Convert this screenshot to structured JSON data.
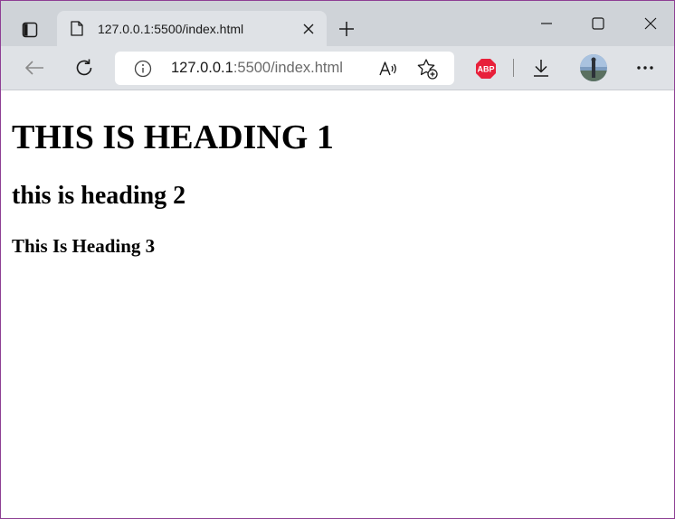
{
  "browser": {
    "tab": {
      "title": "127.0.0.1:5500/index.html",
      "favicon": "page-icon"
    },
    "address_bar": {
      "host": "127.0.0.1",
      "rest": ":5500/index.html",
      "info_icon": "info-icon"
    },
    "toolbar_icons": [
      "back-arrow-icon",
      "refresh-icon",
      "read-aloud-icon",
      "add-favorite-icon",
      "adblock-plus-icon",
      "download-icon",
      "profile-avatar",
      "more-icon"
    ],
    "adblock": {
      "label": "ABP",
      "color": "#e8203a"
    },
    "window_controls": [
      "minimize-icon",
      "maximize-icon",
      "close-icon"
    ]
  },
  "page": {
    "heading1": "THIS IS HEADING 1",
    "heading2": "this is heading 2",
    "heading3": "This Is Heading 3"
  },
  "colors": {
    "tabstrip": "#cfd3d8",
    "toolbar": "#dfe2e6",
    "window_border": "#8e3f94"
  }
}
